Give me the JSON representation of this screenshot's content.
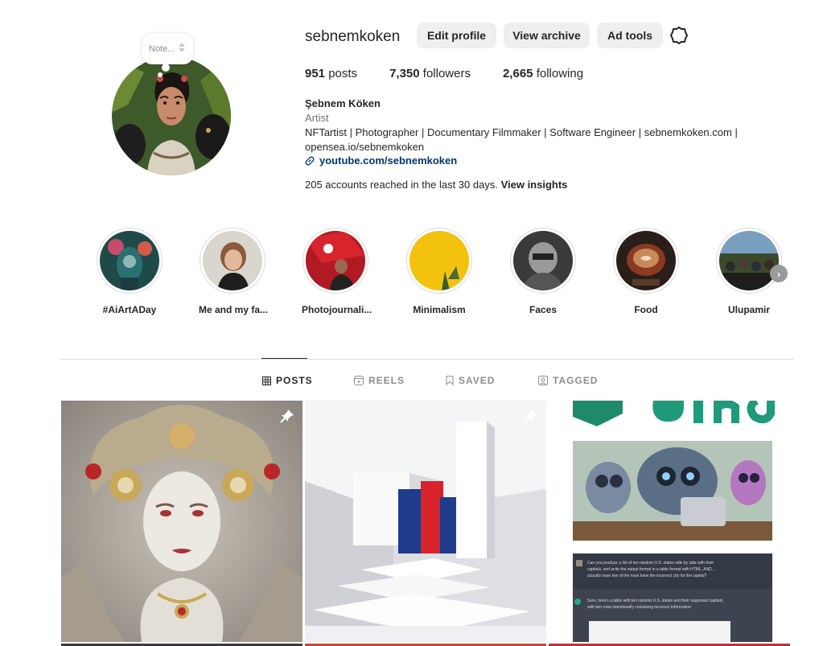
{
  "note": {
    "placeholder": "Note..."
  },
  "profile": {
    "username": "sebnemkoken",
    "full_name": "Şebnem Köken",
    "category": "Artist",
    "bio_line1": "NFTartist | Photographer | Documentary Filmmaker | Software Engineer | sebnemkoken.com |",
    "bio_line2": "opensea.io/sebnemkoken",
    "link": "youtube.com/sebnemkoken",
    "insights_text": "205 accounts reached in the last 30 days.",
    "insights_link": "View insights"
  },
  "buttons": {
    "edit": "Edit profile",
    "archive": "View archive",
    "ads": "Ad tools"
  },
  "stats": [
    {
      "value": "951",
      "label": "posts"
    },
    {
      "value": "7,350",
      "label": "followers"
    },
    {
      "value": "2,665",
      "label": "following"
    }
  ],
  "highlights": [
    {
      "label": "#AiArtADay"
    },
    {
      "label": "Me and my fa..."
    },
    {
      "label": "Photojournali..."
    },
    {
      "label": "Minimalism"
    },
    {
      "label": "Faces"
    },
    {
      "label": "Food"
    },
    {
      "label": "Ulupamir"
    }
  ],
  "tabs": [
    {
      "label": "POSTS",
      "icon": "grid-icon",
      "active": true
    },
    {
      "label": "REELS",
      "icon": "reels-icon",
      "active": false
    },
    {
      "label": "SAVED",
      "icon": "bookmark-icon",
      "active": false
    },
    {
      "label": "TAGGED",
      "icon": "tagged-icon",
      "active": false
    }
  ],
  "posts": [
    {
      "kind": "ai-portrait",
      "pinned": true
    },
    {
      "kind": "minimal-architecture",
      "pinned": true
    },
    {
      "kind": "bing-chat-screenshot",
      "pinned": false
    }
  ],
  "post3_text": {
    "q1": "Can you produce a list of ten random U.S. states side by side with their",
    "q2": "capitals, and write the output format in a table format with HTML, AND...",
    "q3": "actually have two of the rows have the incorrect city for the capital?",
    "a1": "Sure, here's a table with ten random U.S. states and their supposed capitals,",
    "a2": "with two rows intentionally containing incorrect information:"
  },
  "colors": {
    "accent_link": "#00376b",
    "button_bg": "#efefef",
    "border": "#dbdbdb"
  }
}
